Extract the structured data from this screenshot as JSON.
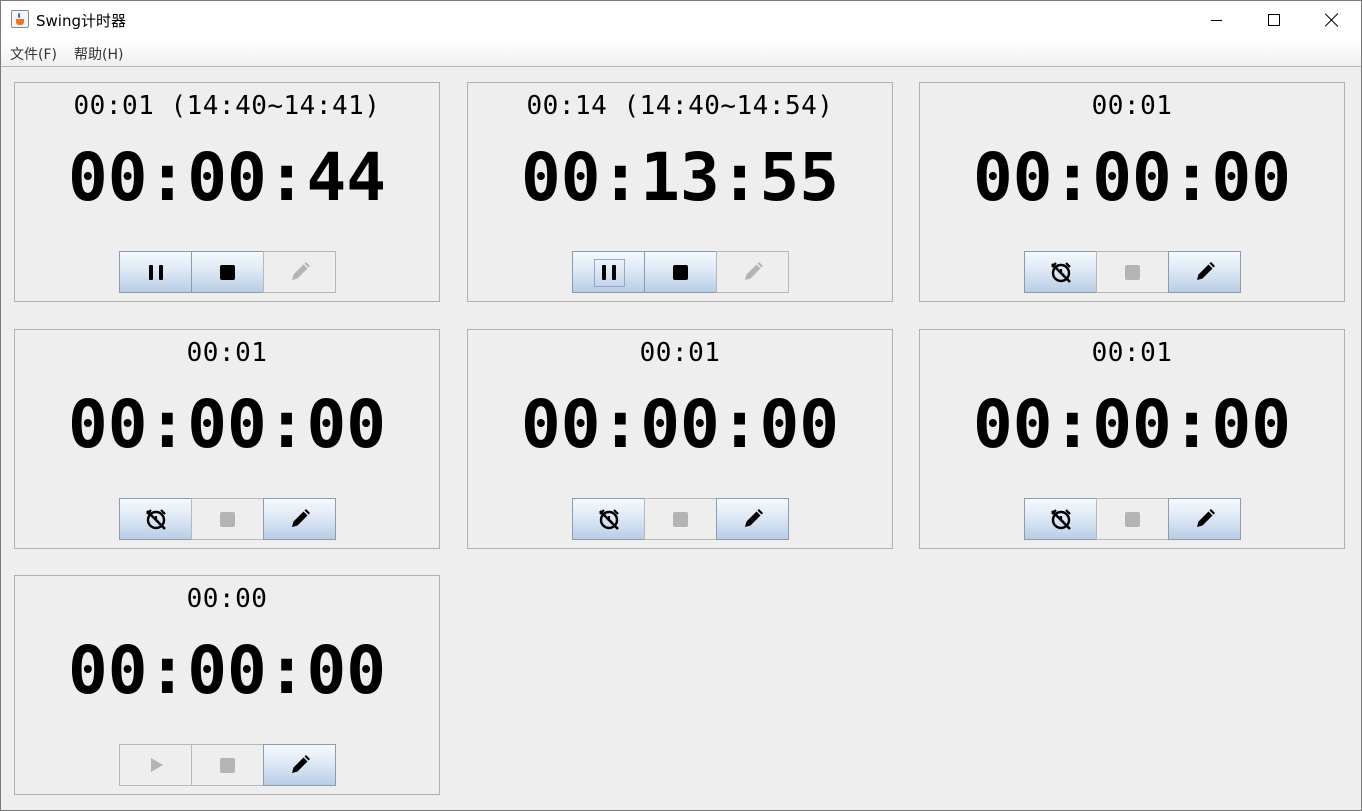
{
  "window": {
    "title": "Swing计时器"
  },
  "menu": {
    "file": "文件(F)",
    "help": "帮助(H)"
  },
  "timers": [
    {
      "label": "00:01 (14:40~14:41)",
      "time": "00:00:44",
      "state": "running",
      "buttons": [
        "pause",
        "stop",
        "edit-disabled"
      ]
    },
    {
      "label": "00:14 (14:40~14:54)",
      "time": "00:13:55",
      "state": "running",
      "buttons": [
        "pause",
        "stop",
        "edit-disabled"
      ]
    },
    {
      "label": "00:01",
      "time": "00:00:00",
      "state": "idle",
      "buttons": [
        "no-alarm",
        "stop-disabled",
        "edit"
      ]
    },
    {
      "label": "00:01",
      "time": "00:00:00",
      "state": "idle",
      "buttons": [
        "no-alarm",
        "stop-disabled",
        "edit"
      ]
    },
    {
      "label": "00:01",
      "time": "00:00:00",
      "state": "idle",
      "buttons": [
        "no-alarm",
        "stop-disabled",
        "edit"
      ]
    },
    {
      "label": "00:01",
      "time": "00:00:00",
      "state": "idle",
      "buttons": [
        "no-alarm",
        "stop-disabled",
        "edit"
      ]
    },
    {
      "label": "00:00",
      "time": "00:00:00",
      "state": "idle",
      "buttons": [
        "play-disabled",
        "stop-disabled",
        "edit"
      ]
    }
  ],
  "colors": {
    "button_gradient_top": "#f5f9fd",
    "button_gradient_bottom": "#b9cde6",
    "disabled_icon": "#b4b4b4",
    "panel_bg": "#eeeeee"
  }
}
